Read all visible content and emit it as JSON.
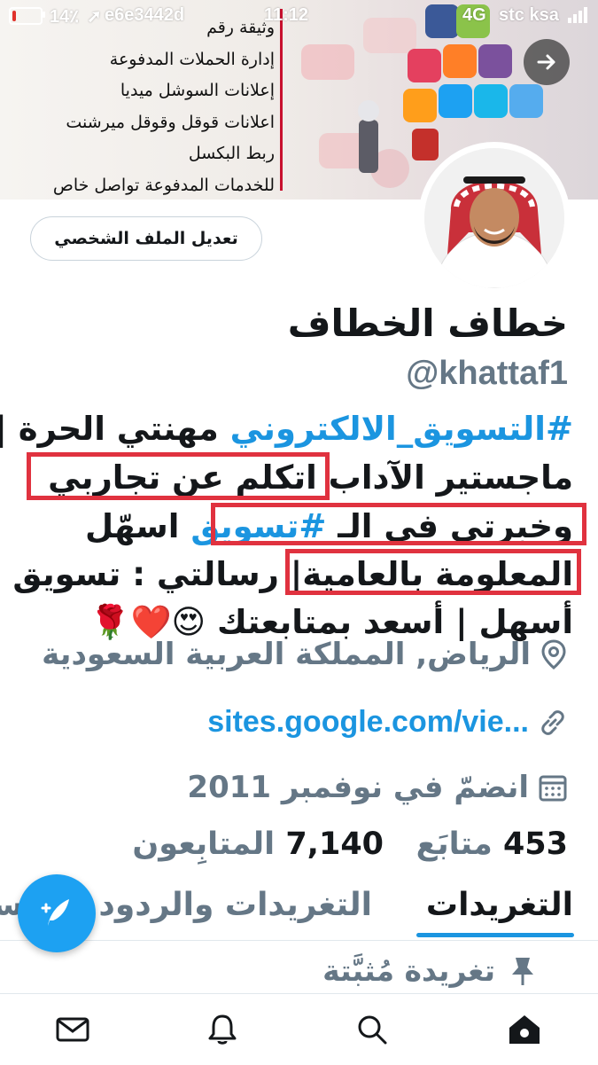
{
  "status_bar": {
    "battery": "14٪",
    "time": "11:12",
    "network": "4G",
    "carrier": "stc ksa",
    "battery_level": 0.14,
    "overlay_code": "e6e3442d"
  },
  "banner": {
    "lines": [
      "وثيقة رقم",
      "إدارة الحملات المدفوعة",
      "إعلانات السوشل ميديا",
      "اعلانات قوقل وقوقل ميرشنت",
      "ربط البكسل",
      "للخدمات المدفوعة تواصل خاص"
    ],
    "divider_color": "#c8102e"
  },
  "profile": {
    "edit_button": "تعديل الملف الشخصي",
    "name": "خطاف الخطاف",
    "handle": "@khattaf1"
  },
  "bio": {
    "line1_hashtag": "#التسويق_الالكتروني",
    "line1_rest": " مهنتي الحرة |",
    "line2_a": "ماجستير الآداب ",
    "line2_b": "اتكلم عن تجاربي",
    "line3_a": "وخبرتي في الـ ",
    "line3_hashtag": "#تسويق",
    "line3_b": " اسهّل",
    "line4_a": "المعلومة بالعامية",
    "line4_b": "| رسالتي : تسويق",
    "line5": "أسهل | أسعد بمتابعتك 😍❤️🌹"
  },
  "info": {
    "location": "الرياض, المملكة العربية السعودية",
    "link": "sites.google.com/vie...",
    "joined": "انضمّ في نوفمبر 2011"
  },
  "stats": {
    "following_count": "453",
    "following_label": "متابَع",
    "followers_count": "7,140",
    "followers_label": "المتابِعون"
  },
  "tabs": {
    "tweets": "التغريدات",
    "tweets_replies": "التغريدات والردود",
    "media": "الوسائط"
  },
  "pinned": {
    "label": "تغريدة مُثبَّتة"
  },
  "colors": {
    "accent": "#1b95e0",
    "highlight": "#e0323f",
    "secondary_text": "#657786"
  },
  "icons": [
    "pin-icon",
    "location-icon",
    "link-icon",
    "calendar-icon",
    "compose-icon",
    "home-icon",
    "search-icon",
    "bell-icon",
    "mail-icon",
    "arrow-right-icon"
  ]
}
